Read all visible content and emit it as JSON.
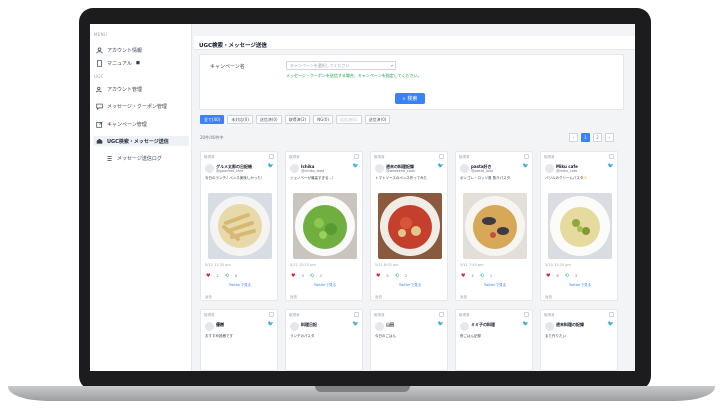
{
  "sidebar": {
    "menu_head": "MENU",
    "ugc_head": "UGC",
    "items": [
      {
        "label": "アカウント情報",
        "icon": "user-icon"
      },
      {
        "label": "マニュアル",
        "icon": "book-icon"
      },
      {
        "label": "アカウント管理",
        "icon": "users-icon"
      },
      {
        "label": "メッセージ・クーポン管理",
        "icon": "chat-icon"
      },
      {
        "label": "キャンペーン管理",
        "icon": "edit-icon"
      },
      {
        "label": "UGC検索・メッセージ送信",
        "icon": "tag-icon"
      },
      {
        "label": "メッセージ送信ログ",
        "icon": "list-icon"
      }
    ]
  },
  "main": {
    "title": "UGC検索・メッセージ送信",
    "campaign_label": "キャンペーン名",
    "campaign_placeholder": "キャンペーンを選択してください",
    "hint": "メッセージ・クーポンを送信する場合、キャンペーンを指定してください。",
    "search_label": "検索",
    "tabs": [
      {
        "label": "全て(40)",
        "active": true
      },
      {
        "label": "未対応(0)"
      },
      {
        "label": "送信済(0)"
      },
      {
        "label": "取得済(2)"
      },
      {
        "label": "NG(0)"
      },
      {
        "label": "返信済(0)",
        "dim": true
      },
      {
        "label": "送信済(0)"
      }
    ],
    "count": "20件/40件中",
    "pages": [
      "‹",
      "1",
      "2",
      "›"
    ]
  },
  "cards": [
    {
      "user": "グルメ太郎の日記帳",
      "handle": "@gourmet_taro",
      "text": "今日のランチ♪ ペンネ美味しかった！",
      "date": "5/12 11:30 pm",
      "likes": "2",
      "rts": "0"
    },
    {
      "user": "Ichika",
      "handle": "@ichika_food",
      "text": "ジェノベーゼ最高すぎる…！",
      "date": "5/12 10:15 pm",
      "likes": "3",
      "rts": "1"
    },
    {
      "user": "週末の料理記録",
      "handle": "@weekend_cook",
      "text": "トマトソースのペンネ作ってみた",
      "date": "5/11 8:02 pm",
      "likes": "5",
      "rts": "2"
    },
    {
      "user": "pasta好き",
      "handle": "@pasta_love",
      "text": "ボンゴレ・ロッソ風 魚介パスタ",
      "date": "5/11 7:40 pm",
      "likes": "4",
      "rts": "1"
    },
    {
      "user": "Miku cafe",
      "handle": "@miku_cafe",
      "text": "バジルのクリームパスタ✨",
      "date": "5/10 12:20 pm",
      "likes": "6",
      "rts": "3"
    }
  ],
  "cards_bottom": [
    {
      "user": "優樹",
      "text": "おすすめ投稿です"
    },
    {
      "user": "料理日記",
      "text": "ランチのパスタ"
    },
    {
      "user": "山田",
      "text": "今日のごはん"
    },
    {
      "user": "ミミ子の料理",
      "text": "夜ごはん記録"
    },
    {
      "user": "週末料理の記録",
      "text": "また作りたい"
    }
  ],
  "card_labels": {
    "view": "Twitterで見る",
    "reply": "返信",
    "status": "取得済"
  }
}
